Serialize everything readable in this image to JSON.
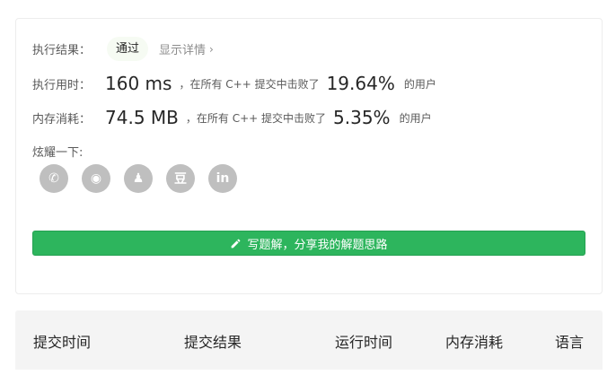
{
  "result": {
    "label": "执行结果：",
    "status": "通过",
    "details_link": "显示详情",
    "details_chevron": "›"
  },
  "runtime": {
    "label": "执行用时：",
    "value": "160 ms",
    "beat_prefix": "，在所有 C++ 提交中击败了",
    "percent": "19.64%",
    "suffix": "的用户"
  },
  "memory": {
    "label": "内存消耗：",
    "value": "74.5 MB",
    "beat_prefix": "，在所有 C++ 提交中击败了",
    "percent": "5.35%",
    "suffix": "的用户"
  },
  "share": {
    "label": "炫耀一下:",
    "buttons": [
      {
        "icon": "wechat-icon",
        "glyph": "✆"
      },
      {
        "icon": "weibo-icon",
        "glyph": "◉"
      },
      {
        "icon": "qq-icon",
        "glyph": "♟"
      },
      {
        "icon": "douban-icon",
        "glyph": "豆"
      },
      {
        "icon": "linkedin-icon",
        "glyph": "in"
      }
    ]
  },
  "cta": {
    "label": "写题解，分享我的解题思路",
    "icon": "pencil-icon"
  },
  "table": {
    "headers": [
      "提交时间",
      "提交结果",
      "运行时间",
      "内存消耗",
      "语言"
    ]
  },
  "colors": {
    "accent_green": "#2db55d",
    "badge_bg": "#f6fbf3",
    "share_gray": "#bfbfbf"
  }
}
